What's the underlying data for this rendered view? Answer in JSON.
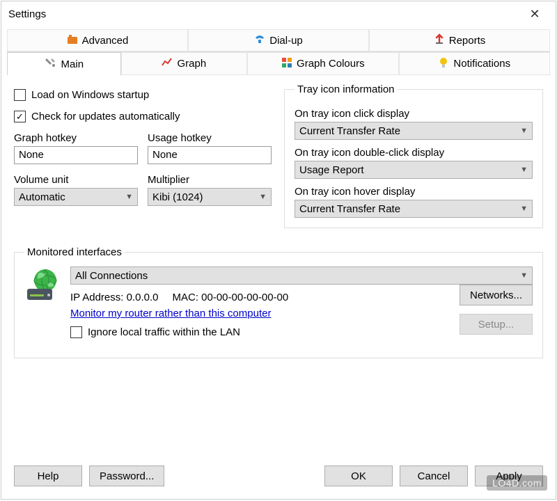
{
  "window": {
    "title": "Settings"
  },
  "tabs_top": [
    {
      "label": "Advanced",
      "icon": "advanced-icon"
    },
    {
      "label": "Dial-up",
      "icon": "dialup-icon"
    },
    {
      "label": "Reports",
      "icon": "reports-icon"
    }
  ],
  "tabs_bottom": [
    {
      "label": "Main",
      "icon": "tools-icon",
      "active": true
    },
    {
      "label": "Graph",
      "icon": "graph-icon"
    },
    {
      "label": "Graph Colours",
      "icon": "colours-icon"
    },
    {
      "label": "Notifications",
      "icon": "bulb-icon"
    }
  ],
  "main": {
    "load_on_startup": {
      "label": "Load on Windows startup",
      "checked": false
    },
    "check_updates": {
      "label": "Check for updates automatically",
      "checked": true
    },
    "graph_hotkey": {
      "label": "Graph hotkey",
      "value": "None"
    },
    "usage_hotkey": {
      "label": "Usage hotkey",
      "value": "None"
    },
    "volume_unit": {
      "label": "Volume unit",
      "value": "Automatic"
    },
    "multiplier": {
      "label": "Multiplier",
      "value": "Kibi (1024)"
    }
  },
  "tray": {
    "legend": "Tray icon information",
    "click": {
      "label": "On tray icon click display",
      "value": "Current Transfer Rate"
    },
    "dblclick": {
      "label": "On tray icon double-click display",
      "value": "Usage Report"
    },
    "hover": {
      "label": "On tray icon hover display",
      "value": "Current Transfer Rate"
    }
  },
  "monitored": {
    "legend": "Monitored interfaces",
    "connection": "All Connections",
    "ip_label": "IP Address:",
    "ip_value": "0.0.0.0",
    "mac_label": "MAC:",
    "mac_value": "00-00-00-00-00-00",
    "router_link": "Monitor my router rather than this computer",
    "ignore_lan": {
      "label": "Ignore local traffic within the LAN",
      "checked": false
    },
    "networks_btn": "Networks...",
    "setup_btn": "Setup..."
  },
  "footer": {
    "help": "Help",
    "password": "Password...",
    "ok": "OK",
    "cancel": "Cancel",
    "apply": "Apply"
  },
  "watermark": "LO4D.com"
}
